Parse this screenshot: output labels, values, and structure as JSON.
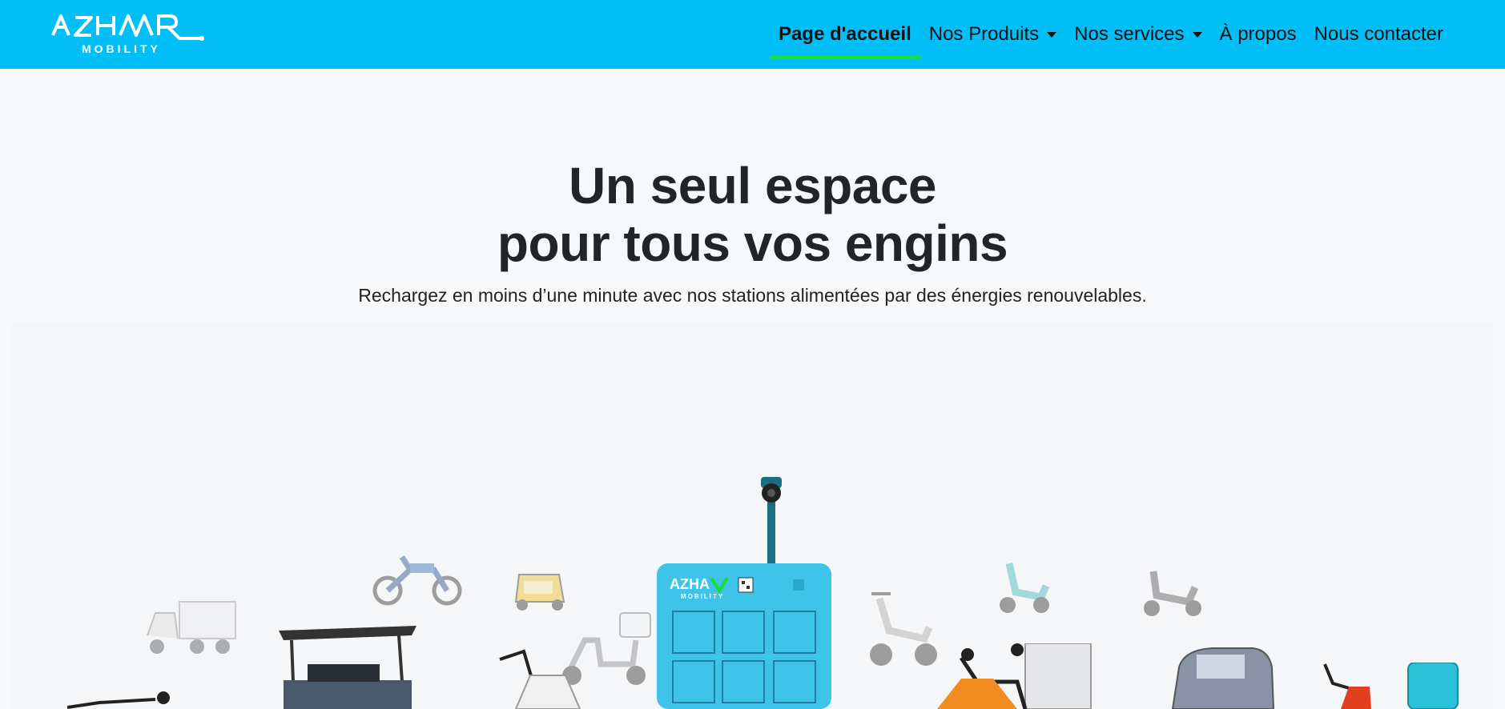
{
  "brand": {
    "logo_text": "AZHAAR",
    "logo_subtext": "MOBILITY",
    "color": "#00bff7",
    "accent": "#19e02e"
  },
  "nav": {
    "items": [
      {
        "label": "Page d'accueil",
        "active": true
      },
      {
        "label": "Nos Produits",
        "dropdown": true
      },
      {
        "label": "Nos services",
        "dropdown": true
      },
      {
        "label": "À propos"
      },
      {
        "label": "Nous contacter"
      }
    ]
  },
  "hero": {
    "title_line1": "Un seul espace",
    "title_line2": "pour tous vos engins",
    "subtitle": "Rechargez en moins d’une minute avec nos stations alimentées par des énergies renouvelables."
  },
  "station": {
    "logo_text": "AZHAAR",
    "logo_subtext": "MOBILITY",
    "color": "#3ec4e8",
    "pole_color": "#1a6f80"
  },
  "vehicles": [
    "cargo-tricycle",
    "golf-cart",
    "motorcycle",
    "tuk-tuk",
    "scooter",
    "electric-scooter",
    "delivery-scooter",
    "mini-car",
    "scooter-teal"
  ]
}
